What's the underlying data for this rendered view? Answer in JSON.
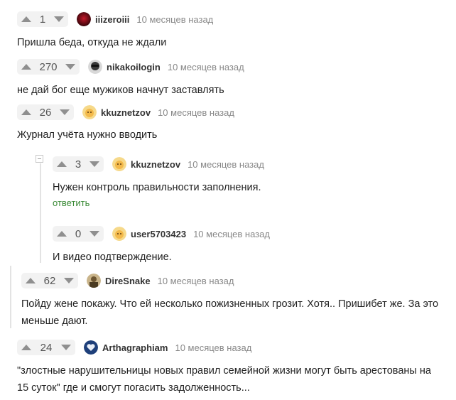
{
  "comments": [
    {
      "score": "1",
      "username": "iiizeroiii",
      "time": "10 месяцев назад",
      "text": "Пришла беда, откуда не ждали"
    },
    {
      "score": "270",
      "username": "nikakoilogin",
      "time": "10 месяцев назад",
      "text": "не дай бог еще мужиков начнут заставлять"
    },
    {
      "score": "26",
      "username": "kkuznetzov",
      "time": "10 месяцев назад",
      "text": "Журнал учёта нужно вводить"
    },
    {
      "score": "3",
      "username": "kkuznetzov",
      "time": "10 месяцев назад",
      "text": "Нужен контроль правильности заполнения.",
      "reply_label": "ответить"
    },
    {
      "score": "0",
      "username": "user5703423",
      "time": "10 месяцев назад",
      "text": "И видео подтверждение."
    },
    {
      "score": "62",
      "username": "DireSnake",
      "time": "10 месяцев назад",
      "text_line1": "Пойду жене покажу. Что ей несколько пожизненных грозит. Хотя.. Пришибет же. За это",
      "text_line2": "меньше дают."
    },
    {
      "score": "24",
      "username": "Arthagraphiam",
      "time": "10 месяцев назад",
      "text_line1": "\"злостные нарушительницы новых правил семейной жизни могут быть арестованы на",
      "text_line2": "15 суток\" где и смогут погасить задолженность..."
    }
  ],
  "icons": {
    "upvote": "triangle-up-icon",
    "downvote": "triangle-down-icon",
    "collapse": "minus-square-icon"
  },
  "colors": {
    "reply_link": "#3a8a36",
    "vote_bg": "#f2f2f2"
  }
}
